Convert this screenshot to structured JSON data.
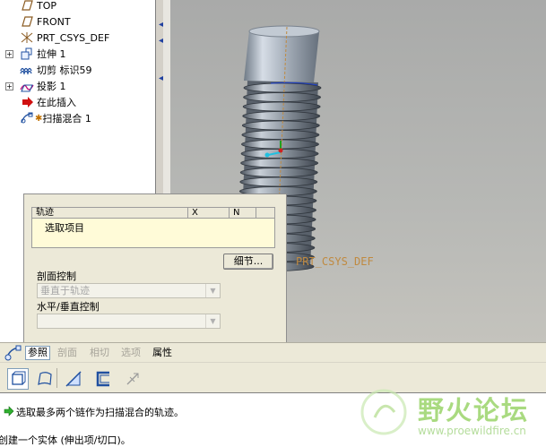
{
  "model_tree": {
    "items": [
      {
        "label": "TOP",
        "icon": "datum-plane-icon"
      },
      {
        "label": "FRONT",
        "icon": "datum-plane-icon"
      },
      {
        "label": "PRT_CSYS_DEF",
        "icon": "coordinate-system-icon"
      },
      {
        "label": "拉伸 1",
        "icon": "extrude-icon"
      },
      {
        "label": "切剪 标识59",
        "icon": "cut-icon"
      },
      {
        "label": "投影 1",
        "icon": "projection-icon"
      },
      {
        "label": "在此插入",
        "icon": "insert-here-arrow-icon"
      },
      {
        "label": "扫描混合 1",
        "icon": "swept-blend-icon"
      }
    ]
  },
  "viewport": {
    "csys_label": "PRT_CSYS_DEF"
  },
  "panel": {
    "trajectory_header": {
      "name": "轨迹",
      "x": "X",
      "n": "N"
    },
    "trajectory_row": "选取项目",
    "details_button": "细节...",
    "section_control_label": "剖面控制",
    "section_control_value": "垂直于轨迹",
    "horizontal_vertical_label": "水平/垂直控制",
    "horizontal_vertical_value": ""
  },
  "tabs": [
    {
      "label": "参照",
      "state": "active"
    },
    {
      "label": "剖面",
      "state": "disabled"
    },
    {
      "label": "相切",
      "state": "disabled"
    },
    {
      "label": "选项",
      "state": "disabled"
    },
    {
      "label": "属性",
      "state": "enabled"
    }
  ],
  "toolbar": {
    "buttons": [
      "solid-icon",
      "surface-icon",
      "cut-material-icon",
      "thicken-icon",
      "blend-direction-icon"
    ]
  },
  "messages": {
    "line1": "选取最多两个链作为扫描混合的轨迹。",
    "line2": "创建一个实体 (伸出项/切口)。"
  },
  "watermark": {
    "title": "野火论坛",
    "url": "www.proewildfire.cn"
  },
  "colors": {
    "viewport_bg": "#b0b1af",
    "panel_bg": "#ece9d8",
    "trajectory_bg": "#fffbd8",
    "csys_label": "#c08a40",
    "watermark": "#9bd46a"
  }
}
